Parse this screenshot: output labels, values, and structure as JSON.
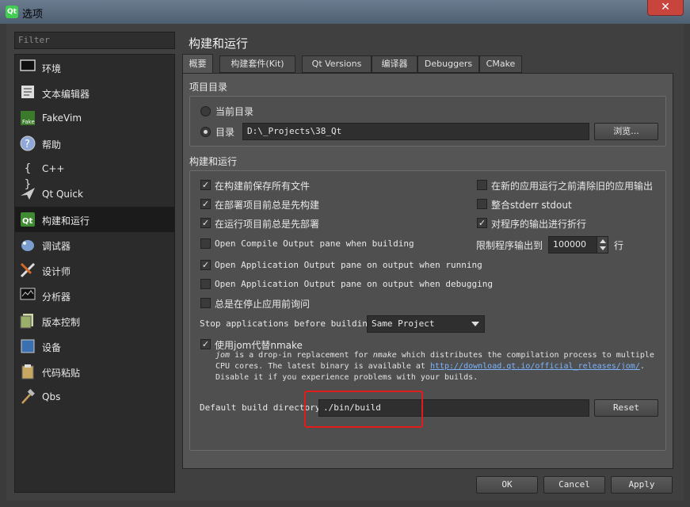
{
  "window": {
    "title": "选项",
    "app_icon": "qt-logo-icon",
    "close_symbol": "✕"
  },
  "filter": {
    "placeholder": "Filter"
  },
  "categories": [
    {
      "label": "环境",
      "icon": "monitor-icon"
    },
    {
      "label": "文本编辑器",
      "icon": "text-editor-icon"
    },
    {
      "label": "FakeVim",
      "icon": "fakevim-icon"
    },
    {
      "label": "帮助",
      "icon": "help-icon"
    },
    {
      "label": "C++",
      "icon": "braces-icon"
    },
    {
      "label": "Qt Quick",
      "icon": "qt-quick-icon"
    },
    {
      "label": "构建和运行",
      "icon": "qt-build-icon",
      "selected": true
    },
    {
      "label": "调试器",
      "icon": "debugger-icon"
    },
    {
      "label": "设计师",
      "icon": "designer-icon"
    },
    {
      "label": "分析器",
      "icon": "analyzer-icon"
    },
    {
      "label": "版本控制",
      "icon": "version-control-icon"
    },
    {
      "label": "设备",
      "icon": "device-icon"
    },
    {
      "label": "代码粘贴",
      "icon": "code-paste-icon"
    },
    {
      "label": "Qbs",
      "icon": "hammer-icon"
    }
  ],
  "page_title": "构建和运行",
  "tabs": [
    "概要",
    "构建套件(Kit)",
    "Qt Versions",
    "编译器",
    "Debuggers",
    "CMake"
  ],
  "project_dir": {
    "title": "项目目录",
    "current_label": "当前目录",
    "dir_label": "目录",
    "dir_value": "D:\\_Projects\\38_Qt",
    "browse_label": "浏览..."
  },
  "build_run": {
    "title": "构建和运行",
    "save_before_build": "在构建前保存所有文件",
    "always_build_before_deploy": "在部署项目前总是先构建",
    "always_deploy_before_run": "在运行项目前总是先部署",
    "open_compile_output": "Open Compile Output pane when building",
    "open_app_output_run": "Open Application Output pane on output when running",
    "open_app_output_debug": "Open Application Output pane on output when debugging",
    "ask_before_stop": "总是在停止应用前询问",
    "clear_old_output": "在新的应用运行之前清除旧的应用输出",
    "merge_stderr": "整合stderr stdout",
    "wrap_output": "对程序的输出进行折行",
    "limit_output_label": "限制程序输出到",
    "limit_output_value": "100000",
    "limit_output_unit": "行",
    "stop_apps_label": "Stop applications before building:",
    "stop_apps_value": "Same Project",
    "use_jom_label": "使用jom代替nmake",
    "jom_desc_1a": "jom",
    "jom_desc_1b": " is a drop-in replacement for ",
    "jom_desc_1c": "nmake",
    "jom_desc_1d": " which distributes the compilation process to multiple",
    "jom_desc_2a": "CPU cores. The latest binary is available at ",
    "jom_desc_2link": "http://download.qt.io/official_releases/jom/",
    "jom_desc_2b": ".",
    "jom_desc_3": "Disable it if you experience problems with your builds.",
    "default_build_dir_label": "Default build directory:",
    "default_build_dir_value": "./bin/build",
    "reset_label": "Reset"
  },
  "checks": {
    "save_before_build": true,
    "always_build_before_deploy": true,
    "always_deploy_before_run": true,
    "open_compile_output": false,
    "open_app_output_run": true,
    "open_app_output_debug": false,
    "ask_before_stop": false,
    "clear_old_output": false,
    "merge_stderr": false,
    "wrap_output": true,
    "use_jom": true
  },
  "footer": {
    "ok_label": "OK",
    "cancel_label": "Cancel",
    "apply_label": "Apply"
  },
  "colors": {
    "highlight_box": "#e21b1b",
    "link": "#7db4ff",
    "title_bar": "#5e6e80"
  }
}
